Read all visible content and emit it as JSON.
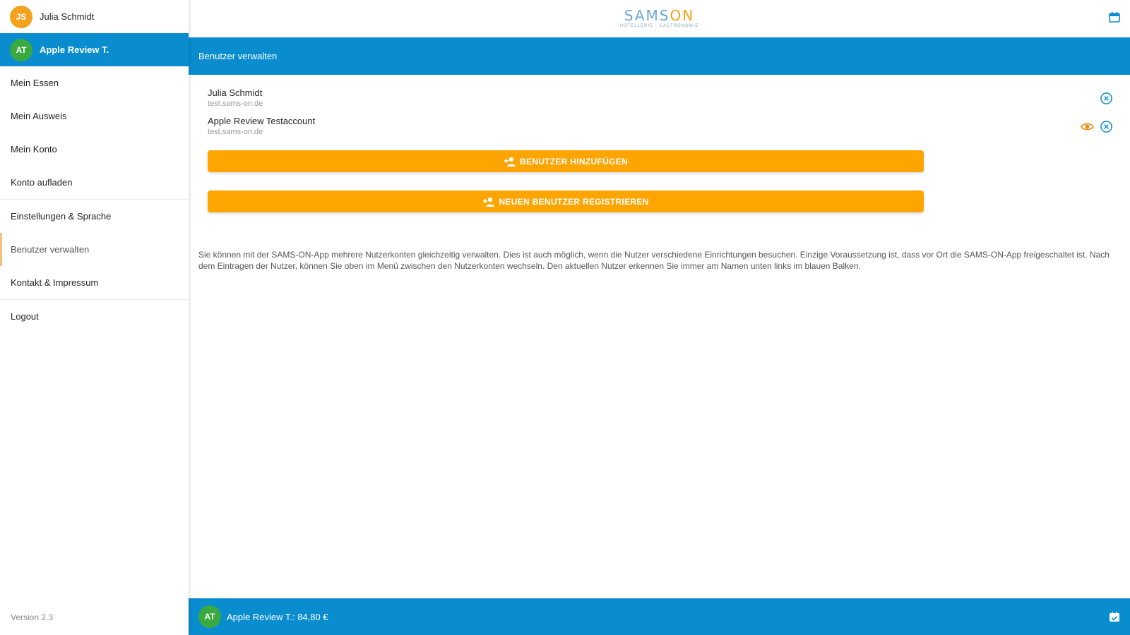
{
  "sidebar": {
    "accounts": [
      {
        "initials": "JS",
        "name": "Julia Schmidt"
      },
      {
        "initials": "AT",
        "name": "Apple Review T."
      }
    ],
    "menu_group1": [
      "Mein Essen",
      "Mein Ausweis",
      "Mein Konto",
      "Konto aufladen"
    ],
    "menu_group2": [
      "Einstellungen & Sprache",
      "Benutzer verwalten",
      "Kontakt & Impressum"
    ],
    "logout": "Logout",
    "version": "Version 2.3"
  },
  "topbar": {
    "logo_main_a": "SAMS",
    "logo_main_b": "ON",
    "logo_sub": "HOTELLERIE - GASTRONOMIE"
  },
  "header": {
    "title": "Benutzer verwalten"
  },
  "users": [
    {
      "name": "Julia Schmidt",
      "email": "test.sams-on.de"
    },
    {
      "name": "Apple Review Testaccount",
      "email": "test.sams-on.de"
    }
  ],
  "buttons": {
    "add_user": "BENUTZER HINZUFÜGEN",
    "register_user": "NEUEN BENUTZER REGISTRIEREN"
  },
  "info_text": "Sie können mit der SAMS-ON-App mehrere Nutzerkonten gleichzeitig verwalten. Dies ist auch möglich, wenn die Nutzer verschiedene Einrichtungen besuchen. Einzige Voraussetzung ist, dass vor Ort die SAMS-ON-App freigeschaltet ist. Nach dem Eintragen der Nutzer, können Sie oben im Menü zwischen den Nutzerkonten wechseln. Den aktuellen Nutzer erkennen Sie immer am Namen unten links im blauen Balken.",
  "bottombar": {
    "initials": "AT",
    "label": "Apple Review T.: 84,80 €"
  },
  "colors": {
    "primary": "#0a8dcf",
    "accent": "#ffa502",
    "avatar_orange": "#f4a21d",
    "avatar_green": "#3aa93f"
  }
}
